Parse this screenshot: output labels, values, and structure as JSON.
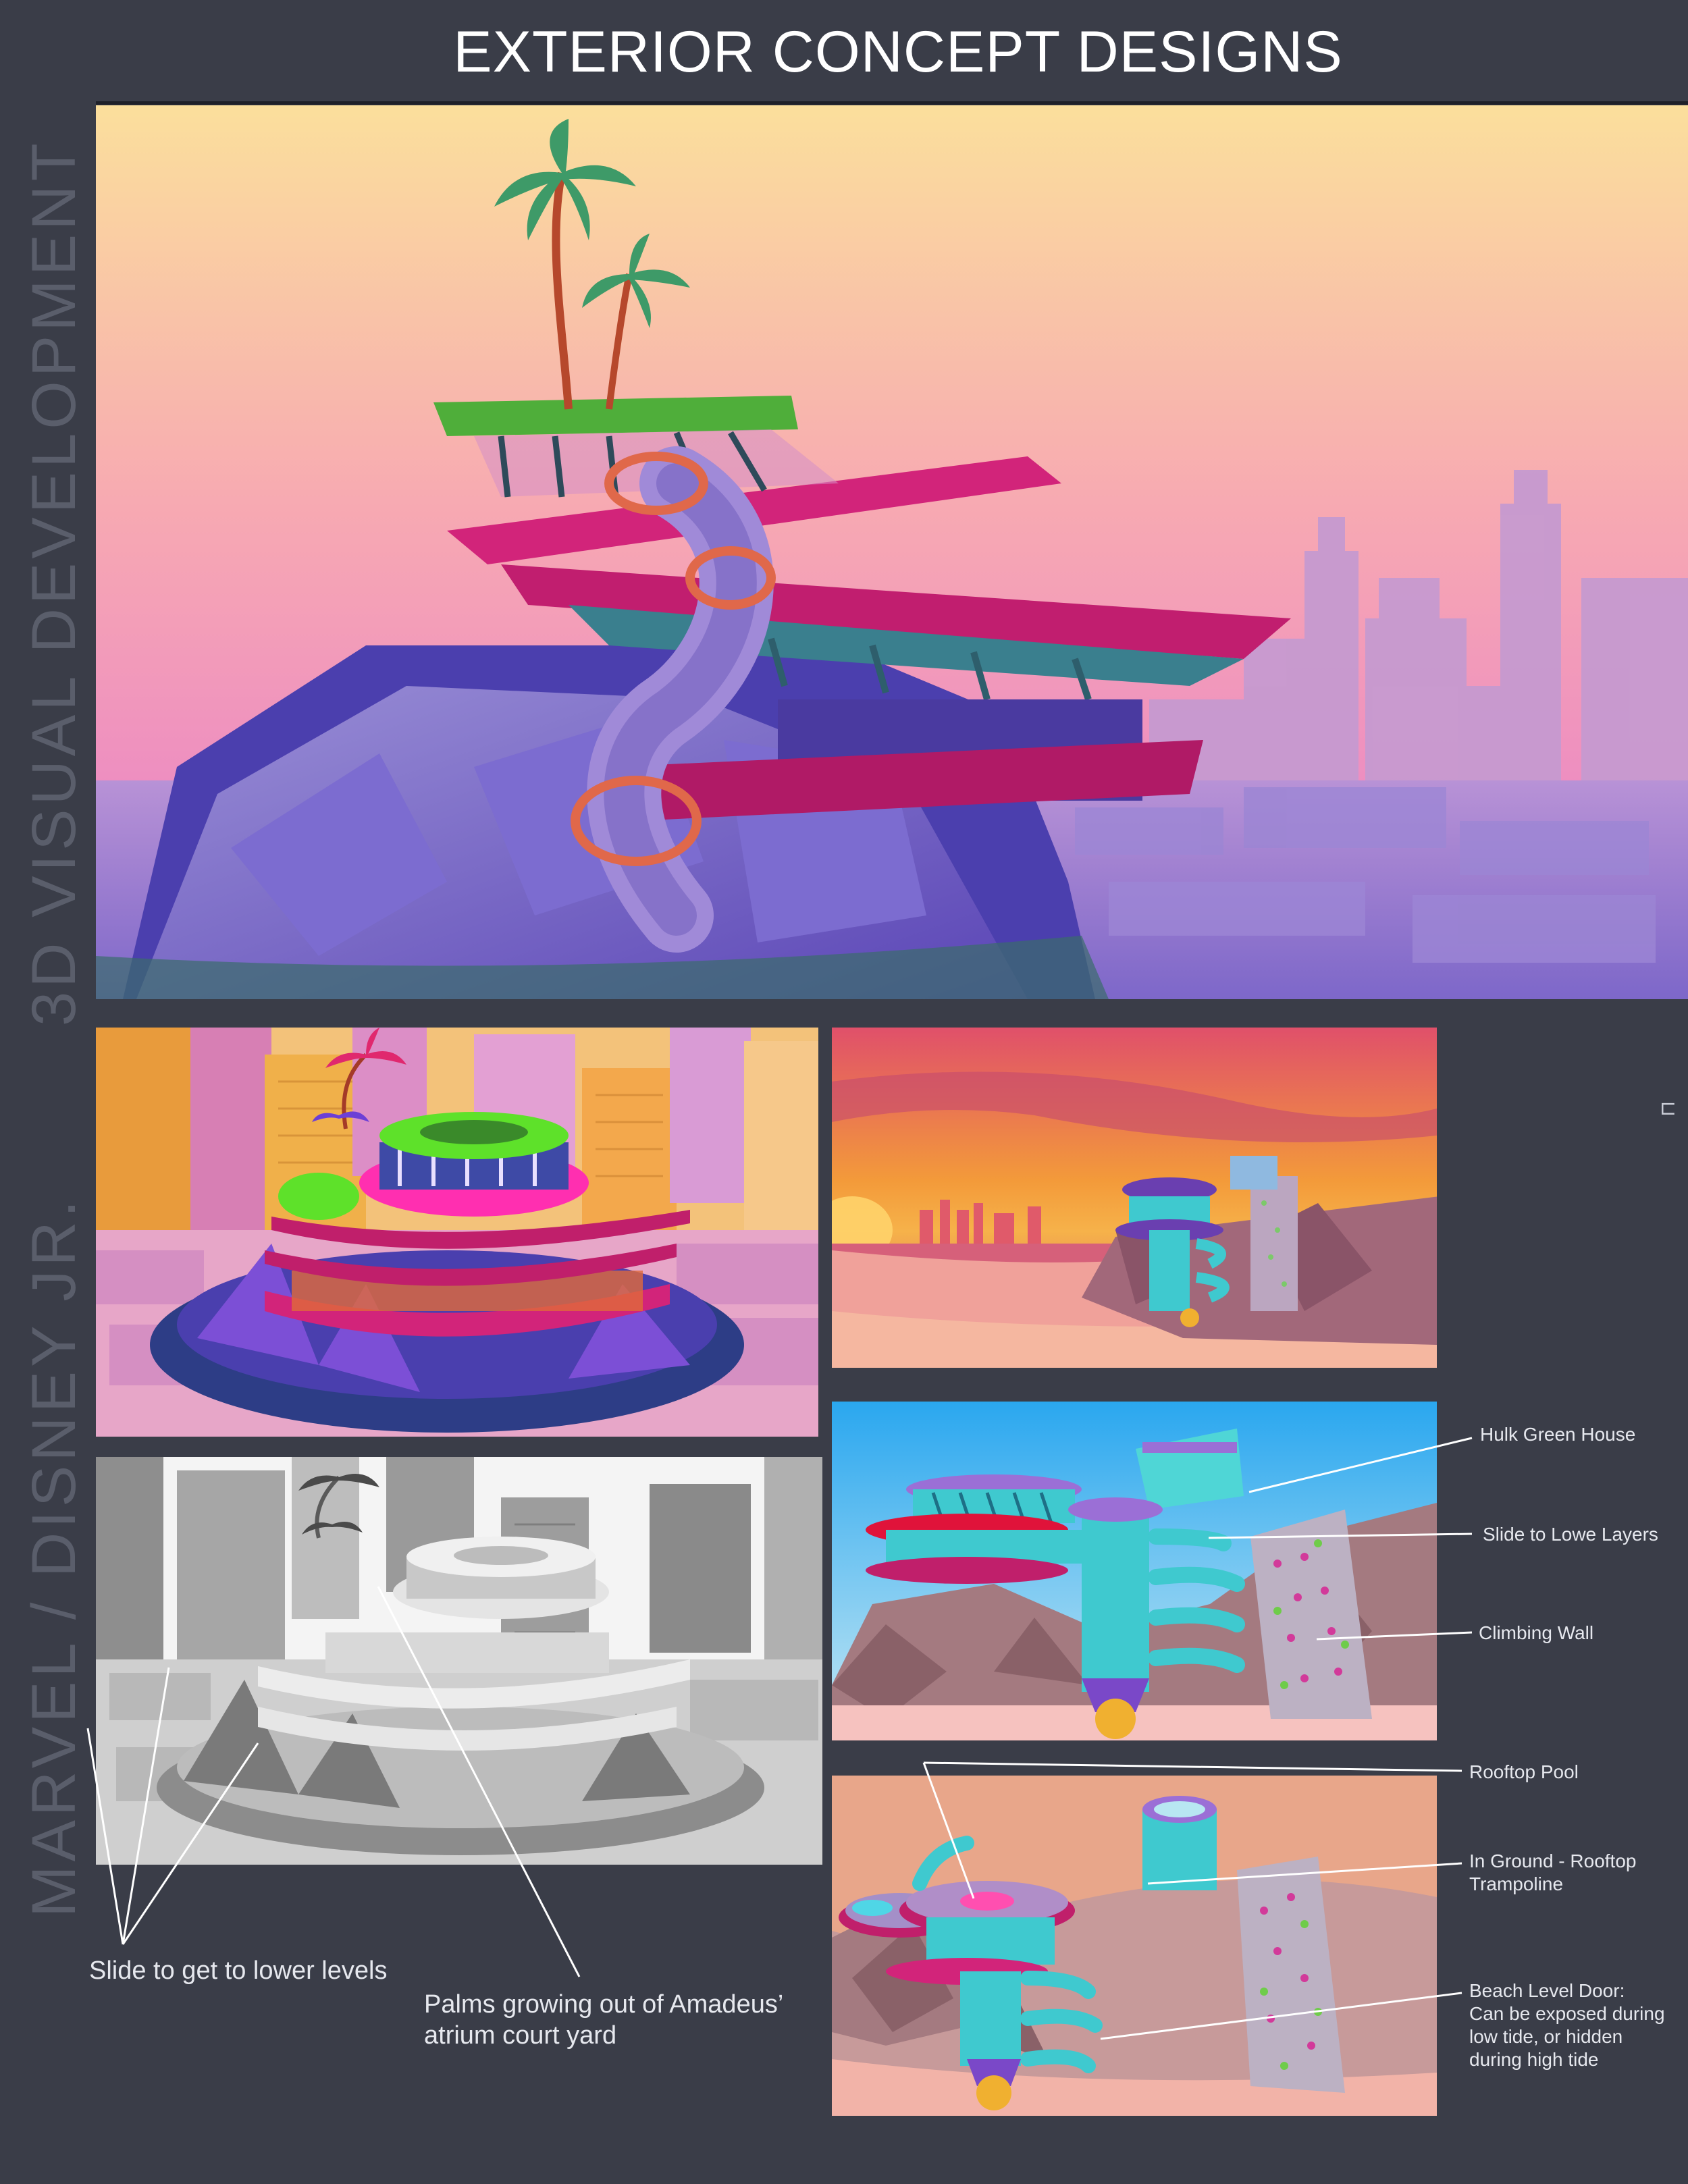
{
  "title": "EXTERIOR CONCEPT DESIGNS",
  "side_label_top": "3D VISUAL DEVELOPMENT",
  "side_label_bottom": "MARVEL / DISNEY JR.",
  "edge_mark": "⊔",
  "captions": {
    "slide": "Slide to get to lower levels",
    "palms_line1": "Palms growing out of Amadeus’",
    "palms_line2": "atrium court yard"
  },
  "annotations": {
    "hulk_green_house": "Hulk Green House",
    "slide_to_lowe_layers": "Slide to Lowe Layers",
    "climbing_wall": "Climbing Wall",
    "rooftop_pool": "Rooftop Pool",
    "in_ground_line1": "In Ground - Rooftop",
    "in_ground_line2": "Trampoline",
    "beach_door_line1": "Beach Level Door:",
    "beach_door_line2": "Can be exposed during",
    "beach_door_line3": "low tide, or hidden",
    "beach_door_line4": "during high tide"
  },
  "colors": {
    "background": "#3a3d48",
    "side_text": "#5a5e6b",
    "sunset_top": "#fbdf9c",
    "sunset_mid": "#f79ab6",
    "sunset_low": "#e06fb8",
    "city_purple": "#8e7cd0",
    "rock_purple": "#6a55c8",
    "accent_magenta": "#d2247a",
    "teal_glass": "#3fc9cf",
    "hulk_green": "#4fae3a"
  }
}
